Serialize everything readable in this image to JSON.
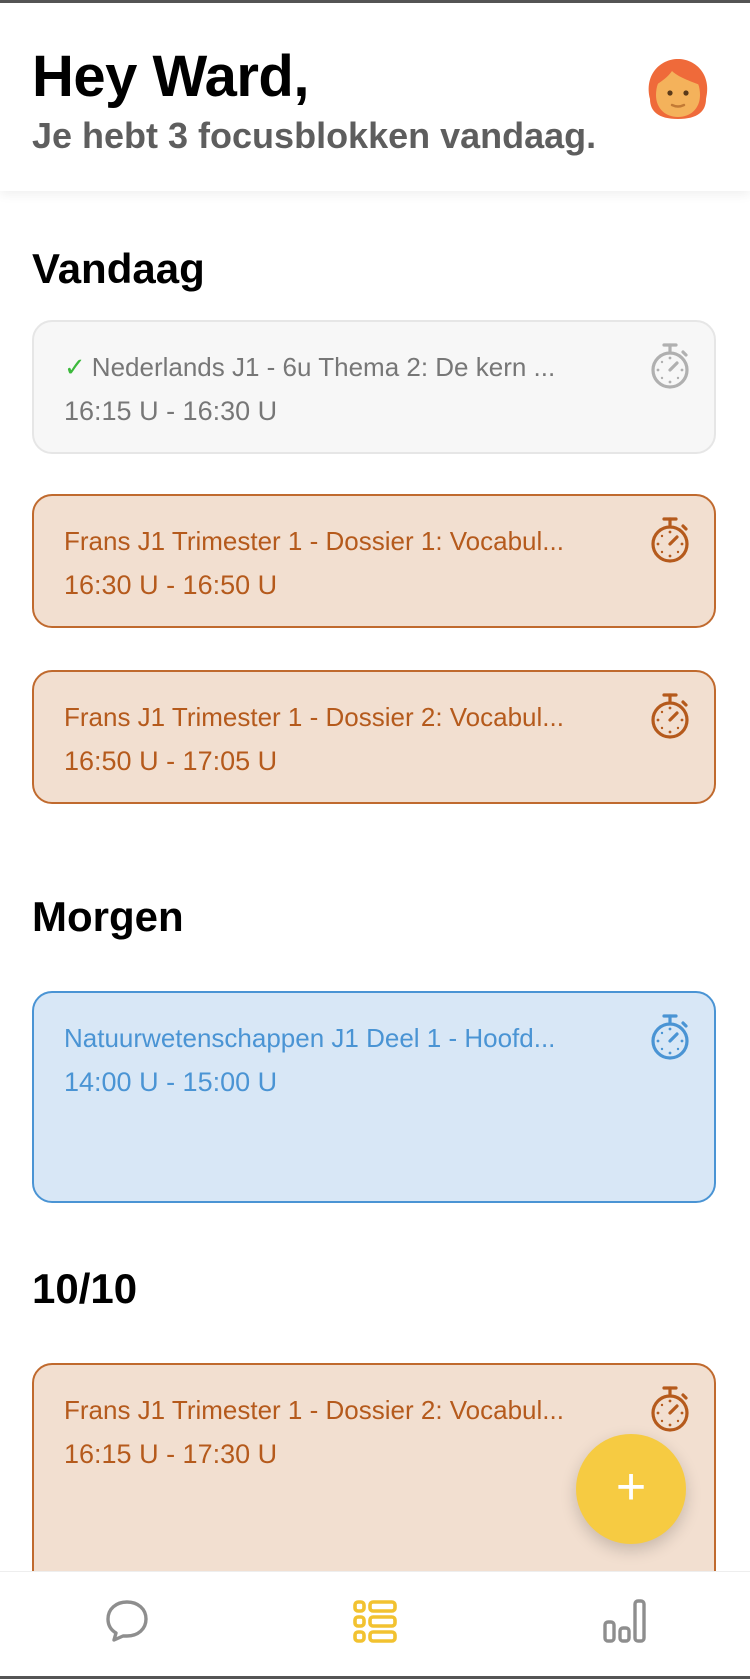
{
  "header": {
    "greeting": "Hey Ward,",
    "subtitle": "Je hebt 3 focusblokken vandaag."
  },
  "sections": [
    {
      "title": "Vandaag",
      "cards": [
        {
          "title": "Nederlands J1 - 6u Thema 2: De kern ...",
          "time": "16:15 U - 16:30 U",
          "style": "done",
          "completed": true,
          "check": "✓"
        },
        {
          "title": "Frans J1 Trimester 1 - Dossier 1: Vocabul...",
          "time": "16:30 U - 16:50 U",
          "style": "orange"
        },
        {
          "title": "Frans J1 Trimester 1 - Dossier 2: Vocabul...",
          "time": "16:50 U - 17:05 U",
          "style": "orange"
        }
      ]
    },
    {
      "title": "Morgen",
      "cards": [
        {
          "title": "Natuurwetenschappen J1 Deel 1 - Hoofd...",
          "time": "14:00 U - 15:00 U",
          "style": "blue"
        }
      ]
    },
    {
      "title": "10/10",
      "cards": [
        {
          "title": "Frans J1 Trimester 1 - Dossier 2: Vocabul...",
          "time": "16:15 U - 17:30 U",
          "style": "orange"
        }
      ]
    }
  ],
  "fab": {
    "label": "+",
    "icon": "plus-icon"
  },
  "nav": {
    "items": [
      {
        "icon": "chat-bubble-icon",
        "active": false
      },
      {
        "icon": "list-grid-icon",
        "active": true
      },
      {
        "icon": "bar-chart-icon",
        "active": false
      }
    ]
  },
  "colors": {
    "orange_text": "#b55a1c",
    "orange_bg": "#f2dfd0",
    "blue_text": "#4a94d4",
    "blue_bg": "#d8e7f6",
    "accent_yellow": "#f6cb42",
    "check_green": "#3cb93c"
  }
}
